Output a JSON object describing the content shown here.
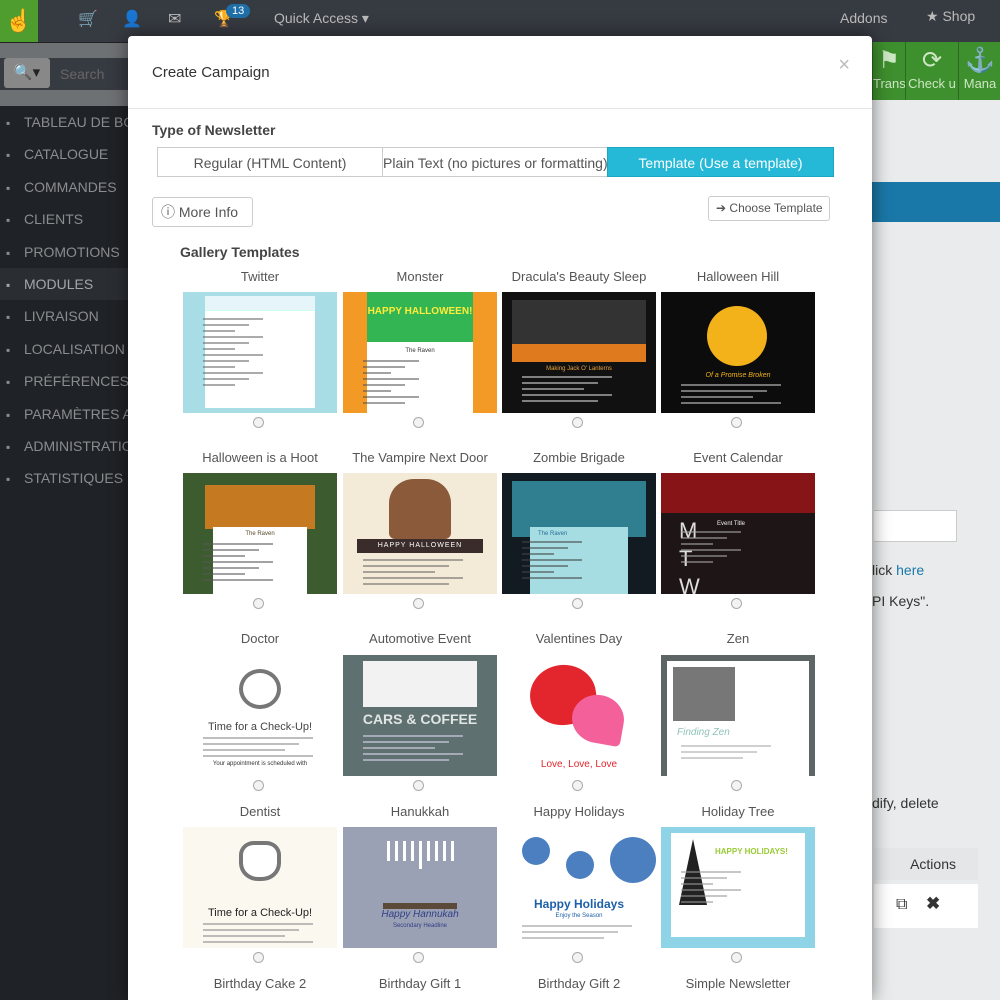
{
  "topbar": {
    "notification_count": "13",
    "quick_access": "Quick Access",
    "addons": "Addons",
    "shop": "Shop"
  },
  "search": {
    "placeholder": "Search"
  },
  "sidebar": {
    "items": [
      {
        "label": "TABLEAU DE BORD",
        "icon": "dashboard-icon"
      },
      {
        "label": "CATALOGUE",
        "icon": "book-icon"
      },
      {
        "label": "COMMANDES",
        "icon": "credit-card-icon"
      },
      {
        "label": "CLIENTS",
        "icon": "users-icon"
      },
      {
        "label": "PROMOTIONS",
        "icon": "tags-icon"
      },
      {
        "label": "MODULES",
        "icon": "puzzle-icon",
        "active": true
      },
      {
        "label": "LIVRAISON",
        "icon": "truck-icon"
      },
      {
        "label": "LOCALISATION",
        "icon": "globe-icon"
      },
      {
        "label": "PRÉFÉRENCES",
        "icon": "wrench-icon"
      },
      {
        "label": "PARAMÈTRES AVANCÉS",
        "icon": "cogs-icon"
      },
      {
        "label": "ADMINISTRATION",
        "icon": "cog-icon"
      },
      {
        "label": "STATISTIQUES",
        "icon": "bar-chart-icon"
      }
    ]
  },
  "toolbar": {
    "translate_label": "Translate",
    "check_label": "Check u",
    "manage_label": "Mana"
  },
  "background": {
    "click_text": "lick ",
    "here_link": "here",
    "api_keys_text": "PI Keys\".",
    "modify_text": "dify, delete",
    "actions_header": "Actions"
  },
  "modal": {
    "title": "Create Campaign",
    "close": "×",
    "type_label": "Type of Newsletter",
    "types": [
      {
        "label": "Regular (HTML Content)",
        "active": false
      },
      {
        "label": "Plain Text (no pictures or formatting)",
        "active": false
      },
      {
        "label": "Template (Use a template)",
        "active": true
      }
    ],
    "more_info": "More Info",
    "choose_template": "Choose Template",
    "gallery_title": "Gallery Templates"
  },
  "templates": [
    {
      "name": "Twitter",
      "bg": "#a8dde6",
      "accent": "#2a8fc4",
      "style": "doc"
    },
    {
      "name": "Monster",
      "bg": "#f39a26",
      "accent": "#33b553",
      "style": "halloween",
      "headline": "HAPPY HALLOWEEN!",
      "sub": "The Raven"
    },
    {
      "name": "Dracula's Beauty Sleep",
      "bg": "#111111",
      "accent": "#e07a1f",
      "style": "dark",
      "sub": "Making Jack O' Lanterns"
    },
    {
      "name": "Halloween Hill",
      "bg": "#0c0c0c",
      "accent": "#f3b21a",
      "style": "moon",
      "sub": "Of a Promise Broken"
    },
    {
      "name": "Halloween is a Hoot",
      "bg": "#3c5b2f",
      "accent": "#c57a22",
      "style": "owl",
      "sub": "The Raven"
    },
    {
      "name": "The Vampire Next Door",
      "bg": "#f3ead8",
      "accent": "#a4712d",
      "style": "vampire",
      "headline": "HAPPY HALLOWEEN"
    },
    {
      "name": "Zombie Brigade",
      "bg": "#121a22",
      "accent": "#3db3c4",
      "style": "zombie",
      "sub": "The Raven"
    },
    {
      "name": "Event Calendar",
      "bg": "#1e1616",
      "accent": "#b3161a",
      "style": "event",
      "letters": "MTW",
      "sub": "Event Title"
    },
    {
      "name": "Doctor",
      "bg": "#ffffff",
      "accent": "#444444",
      "style": "doctor",
      "headline": "Time for a Check-Up!",
      "sub": "Your appointment is scheduled with"
    },
    {
      "name": "Automotive Event",
      "bg": "#5f7071",
      "accent": "#e1e6e5",
      "style": "car",
      "headline": "CARS & COFFEE"
    },
    {
      "name": "Valentines Day",
      "bg": "#ffffff",
      "accent": "#e3262d",
      "style": "heart",
      "headline": "Love, Love, Love"
    },
    {
      "name": "Zen",
      "bg": "#5d6664",
      "accent": "#8fc3b8",
      "style": "zen",
      "headline": "Finding Zen"
    },
    {
      "name": "Dentist",
      "bg": "#fbf8ef",
      "accent": "#222222",
      "style": "dentist",
      "headline": "Time for a Check-Up!"
    },
    {
      "name": "Hanukkah",
      "bg": "#9ba1b4",
      "accent": "#314086",
      "style": "hanukkah",
      "headline": "Happy Hannukah",
      "sub": "Secondary Headline"
    },
    {
      "name": "Happy Holidays",
      "bg": "#ffffff",
      "accent": "#1d5fa8",
      "style": "holidays",
      "headline": "Happy Holidays",
      "sub": "Enjoy the Season"
    },
    {
      "name": "Holiday Tree",
      "bg": "#8fd3e6",
      "accent": "#9acb35",
      "style": "tree",
      "headline": "HAPPY HOLIDAYS!"
    },
    {
      "name": "Birthday Cake 2"
    },
    {
      "name": "Birthday Gift 1"
    },
    {
      "name": "Birthday Gift 2"
    },
    {
      "name": "Simple Newsletter"
    }
  ]
}
